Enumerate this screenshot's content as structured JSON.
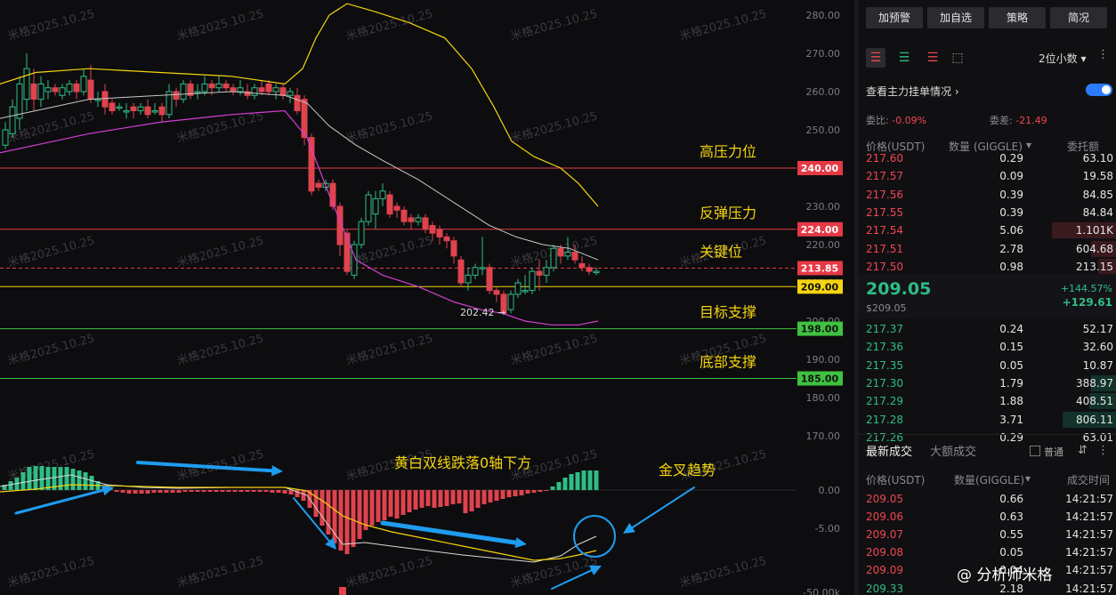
{
  "watermark": "米格2025.10.25",
  "chart_data": {
    "type": "candlestick",
    "y_axis_ticks": [
      "280.00",
      "270.00",
      "260.00",
      "250.00",
      "240.00",
      "230.00",
      "220.00",
      "210.00",
      "200.00",
      "190.00",
      "180.00",
      "170.00",
      "0.00",
      "-5.00",
      "-50.00k"
    ],
    "price_tags": [
      {
        "value": "240.00",
        "color": "#e63946"
      },
      {
        "value": "224.00",
        "color": "#e63946"
      },
      {
        "value": "213.85",
        "color": "#e63946"
      },
      {
        "value": "209.00",
        "color": "#f5d40f"
      },
      {
        "value": "198.00",
        "color": "#3fc23f"
      },
      {
        "value": "185.00",
        "color": "#3fc23f"
      }
    ],
    "level_lines": [
      {
        "value": 240,
        "label": "高压力位",
        "color": "#e63946"
      },
      {
        "value": 224,
        "label": "反弹压力",
        "color": "#e63946"
      },
      {
        "value": 213.85,
        "label": "关键位",
        "color": "#e63946",
        "dashed": true
      },
      {
        "value": 209,
        "label": "",
        "color": "#f5d40f"
      },
      {
        "value": 198,
        "label": "目标支撑",
        "color": "#3fc23f"
      },
      {
        "value": 185,
        "label": "底部支撑",
        "color": "#3fc23f"
      }
    ],
    "low_marker": "202.42 →",
    "annotations": {
      "macd_text": "黄白双线跌落0轴下方",
      "cross_text": "金叉趋势"
    },
    "price_range": [
      170,
      280
    ]
  },
  "toolbar": {
    "buttons": [
      "加预警",
      "加自选",
      "策略",
      "简况"
    ]
  },
  "orderbook": {
    "decimals": "2位小数",
    "title": "查看主力挂单情况",
    "ratio_label": "委比:",
    "ratio_value": "-0.09%",
    "diff_label": "委差:",
    "diff_value": "-21.49",
    "headers": [
      "价格(USDT)",
      "数量 (GIGGLE)",
      "委托额"
    ],
    "asks": [
      [
        "217.60",
        "0.29",
        "63.10"
      ],
      [
        "217.57",
        "0.09",
        "19.58"
      ],
      [
        "217.56",
        "0.39",
        "84.85"
      ],
      [
        "217.55",
        "0.39",
        "84.84"
      ],
      [
        "217.54",
        "5.06",
        "1.101K"
      ],
      [
        "217.51",
        "2.78",
        "604.68"
      ],
      [
        "217.50",
        "0.98",
        "213.15"
      ]
    ],
    "last_price": "209.05",
    "last_price_sub": "$209.05",
    "change_pct": "+144.57%",
    "change_abs": "+129.61",
    "bids": [
      [
        "217.37",
        "0.24",
        "52.17"
      ],
      [
        "217.36",
        "0.15",
        "32.60"
      ],
      [
        "217.35",
        "0.05",
        "10.87"
      ],
      [
        "217.30",
        "1.79",
        "388.97"
      ],
      [
        "217.29",
        "1.88",
        "408.51"
      ],
      [
        "217.28",
        "3.71",
        "806.11"
      ],
      [
        "217.26",
        "0.29",
        "63.01"
      ]
    ]
  },
  "trades": {
    "tab_latest": "最新成交",
    "tab_large": "大额成交",
    "normal_label": "普通",
    "headers": [
      "价格(USDT)",
      "数量(GIGGLE)",
      "成交时间"
    ],
    "rows": [
      [
        "209.05",
        "0.66",
        "14:21:57"
      ],
      [
        "209.06",
        "0.63",
        "14:21:57"
      ],
      [
        "209.07",
        "0.55",
        "14:21:57"
      ],
      [
        "209.08",
        "0.05",
        "14:21:57"
      ],
      [
        "209.09",
        "0.04",
        "14:21:57"
      ],
      [
        "209.33",
        "2.18",
        "14:21:57"
      ]
    ]
  },
  "footer_brand": "@ 分析师米格"
}
